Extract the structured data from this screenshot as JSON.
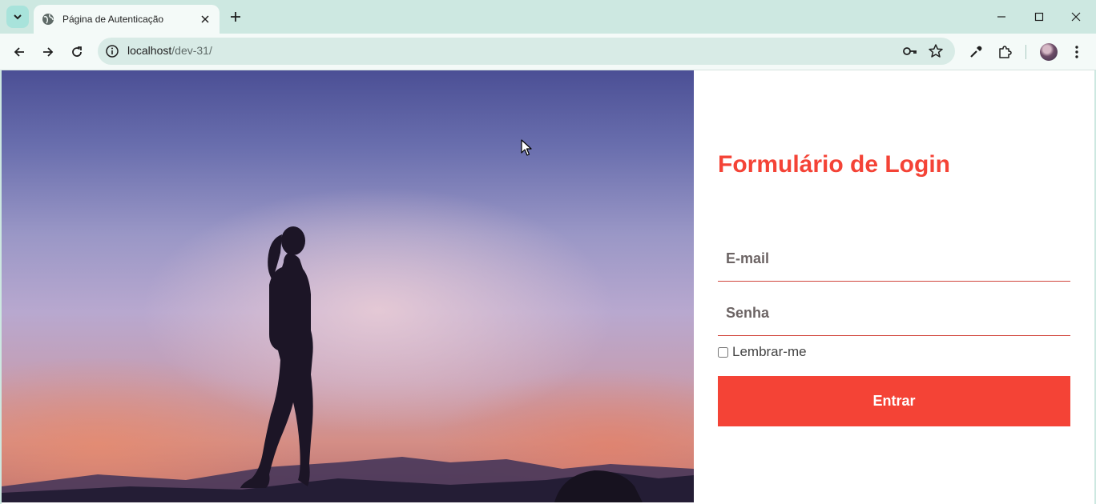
{
  "browser": {
    "tab_title": "Página de Autenticação",
    "url_host": "localhost",
    "url_path": "/dev-31/"
  },
  "icons": {
    "tab_search": "chevron-down-icon",
    "tab_favicon": "globe-icon",
    "tab_close": "close-icon",
    "new_tab": "plus-icon",
    "minimize": "minimize-icon",
    "maximize": "maximize-icon",
    "window_close": "close-icon",
    "back": "back-arrow-icon",
    "forward": "forward-arrow-icon",
    "reload": "reload-icon",
    "site_info": "info-icon",
    "password": "key-icon",
    "bookmark": "star-icon",
    "eyedropper": "eyedropper-icon",
    "extensions": "puzzle-icon",
    "menu": "kebab-menu-icon"
  },
  "login": {
    "title": "Formulário de Login",
    "email_placeholder": "E-mail",
    "password_placeholder": "Senha",
    "remember_label": "Lembrar-me",
    "submit_label": "Entrar"
  },
  "colors": {
    "accent": "#f44336",
    "browser_frame": "#cde8e1",
    "omnibox": "#d8ebe6"
  }
}
